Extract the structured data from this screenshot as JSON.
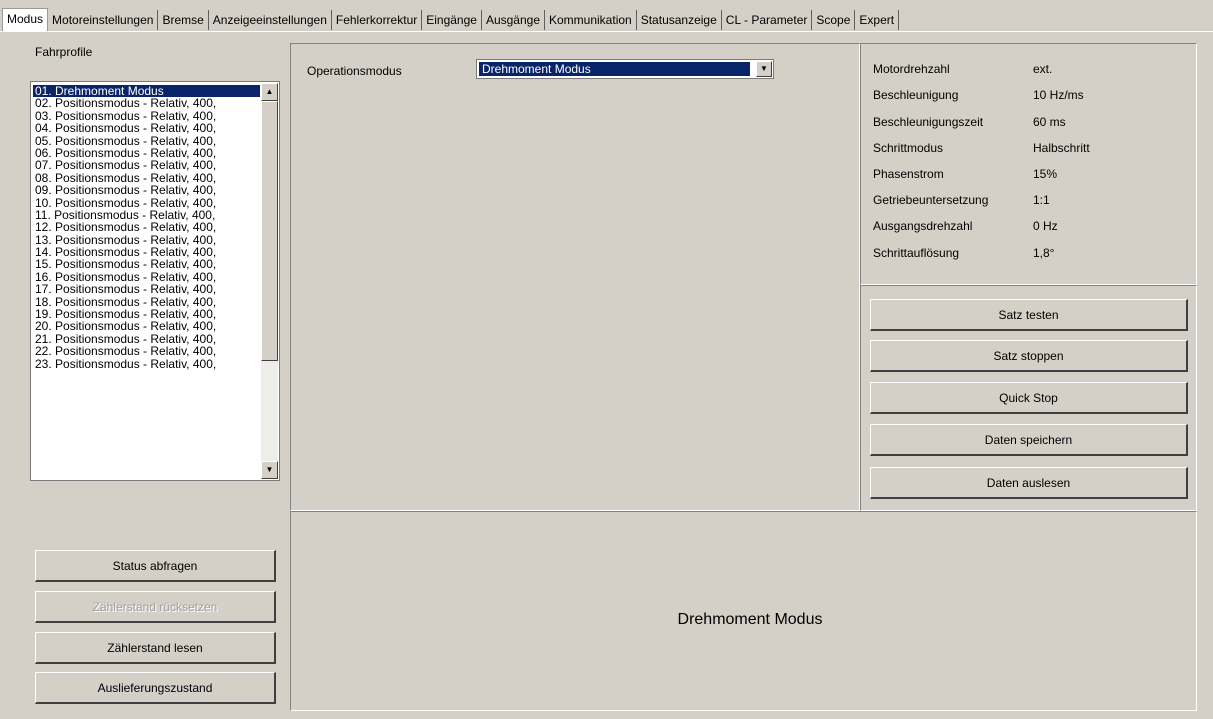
{
  "tabs": [
    "Modus",
    "Motoreinstellungen",
    "Bremse",
    "Anzeigeeinstellungen",
    "Fehlerkorrektur",
    "Eingänge",
    "Ausgänge",
    "Kommunikation",
    "Statusanzeige",
    "CL - Parameter",
    "Scope",
    "Expert"
  ],
  "profiles": {
    "title": "Fahrprofile",
    "items": [
      "01. Drehmoment Modus",
      "02. Positionsmodus - Relativ,  400,",
      "03. Positionsmodus - Relativ,  400,",
      "04. Positionsmodus - Relativ,  400,",
      "05. Positionsmodus - Relativ,  400,",
      "06. Positionsmodus - Relativ,  400,",
      "07. Positionsmodus - Relativ,  400,",
      "08. Positionsmodus - Relativ,  400,",
      "09. Positionsmodus - Relativ,  400,",
      "10. Positionsmodus - Relativ,  400,",
      "11. Positionsmodus - Relativ,  400,",
      "12. Positionsmodus - Relativ,  400,",
      "13. Positionsmodus - Relativ,  400,",
      "14. Positionsmodus - Relativ,  400,",
      "15. Positionsmodus - Relativ,  400,",
      "16. Positionsmodus - Relativ,  400,",
      "17. Positionsmodus - Relativ,  400,",
      "18. Positionsmodus - Relativ,  400,",
      "19. Positionsmodus - Relativ,  400,",
      "20. Positionsmodus - Relativ,  400,",
      "21. Positionsmodus - Relativ,  400,",
      "22. Positionsmodus - Relativ,  400,",
      "23. Positionsmodus - Relativ,  400,"
    ]
  },
  "left_buttons": {
    "status": "Status abfragen",
    "reset_counter": "Zählerstand rücksetzen",
    "read_counter": "Zählerstand lesen",
    "factory": "Auslieferungszustand"
  },
  "operation": {
    "label": "Operationsmodus",
    "value": "Drehmoment Modus"
  },
  "info": [
    {
      "key": "Motordrehzahl",
      "value": "ext."
    },
    {
      "key": "Beschleunigung",
      "value": "10 Hz/ms"
    },
    {
      "key": "Beschleunigungszeit",
      "value": "60 ms"
    },
    {
      "key": "Schrittmodus",
      "value": "Halbschritt"
    },
    {
      "key": "Phasenstrom",
      "value": "15%"
    },
    {
      "key": "Getriebeuntersetzung",
      "value": "1:1"
    },
    {
      "key": "Ausgangsdrehzahl",
      "value": "0 Hz"
    },
    {
      "key": "Schrittauflösung",
      "value": "1,8°"
    }
  ],
  "right_buttons": {
    "test": "Satz testen",
    "stop": "Satz stoppen",
    "quick_stop": "Quick Stop",
    "save": "Daten speichern",
    "read": "Daten auslesen"
  },
  "mode_display": "Drehmoment Modus",
  "icons": {
    "scroll_up": "▲",
    "scroll_down": "▼",
    "combo_dropdown": "▼"
  }
}
